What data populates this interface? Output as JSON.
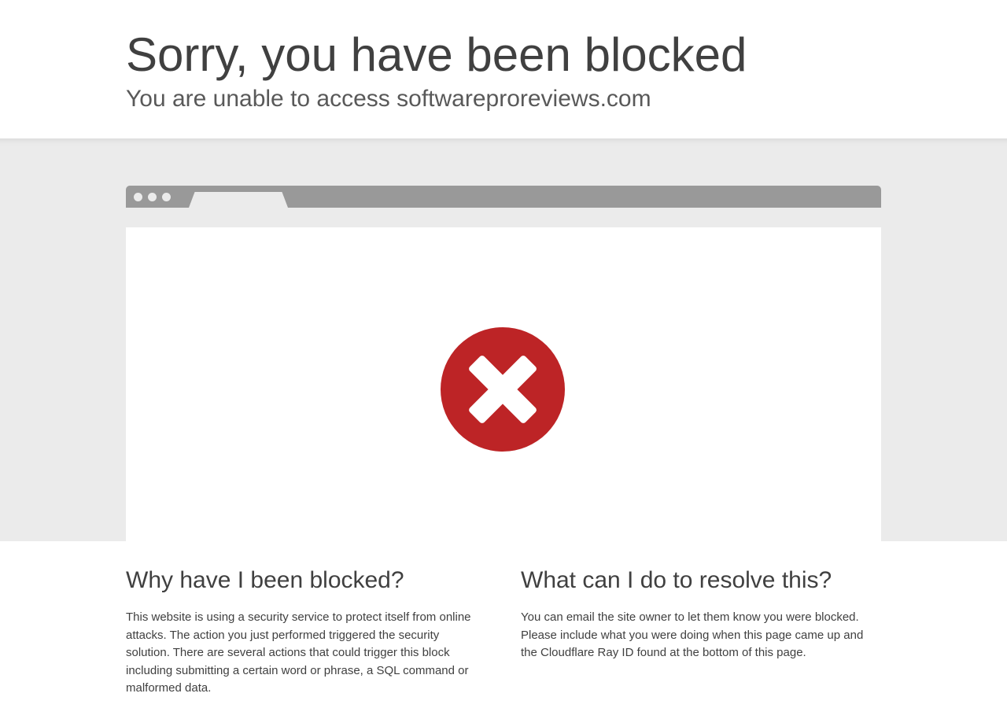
{
  "header": {
    "title": "Sorry, you have been blocked",
    "subtitle": "You are unable to access softwareproreviews.com"
  },
  "illustration": {
    "icon": "blocked-x-icon",
    "icon_color": "#bd2426"
  },
  "why": {
    "heading": "Why have I been blocked?",
    "body": "This website is using a security service to protect itself from online attacks. The action you just performed triggered the security solution. There are several actions that could trigger this block including submitting a certain word or phrase, a SQL command or malformed data."
  },
  "resolve": {
    "heading": "What can I do to resolve this?",
    "body": "You can email the site owner to let them know you were blocked. Please include what you were doing when this page came up and the Cloudflare Ray ID found at the bottom of this page."
  }
}
